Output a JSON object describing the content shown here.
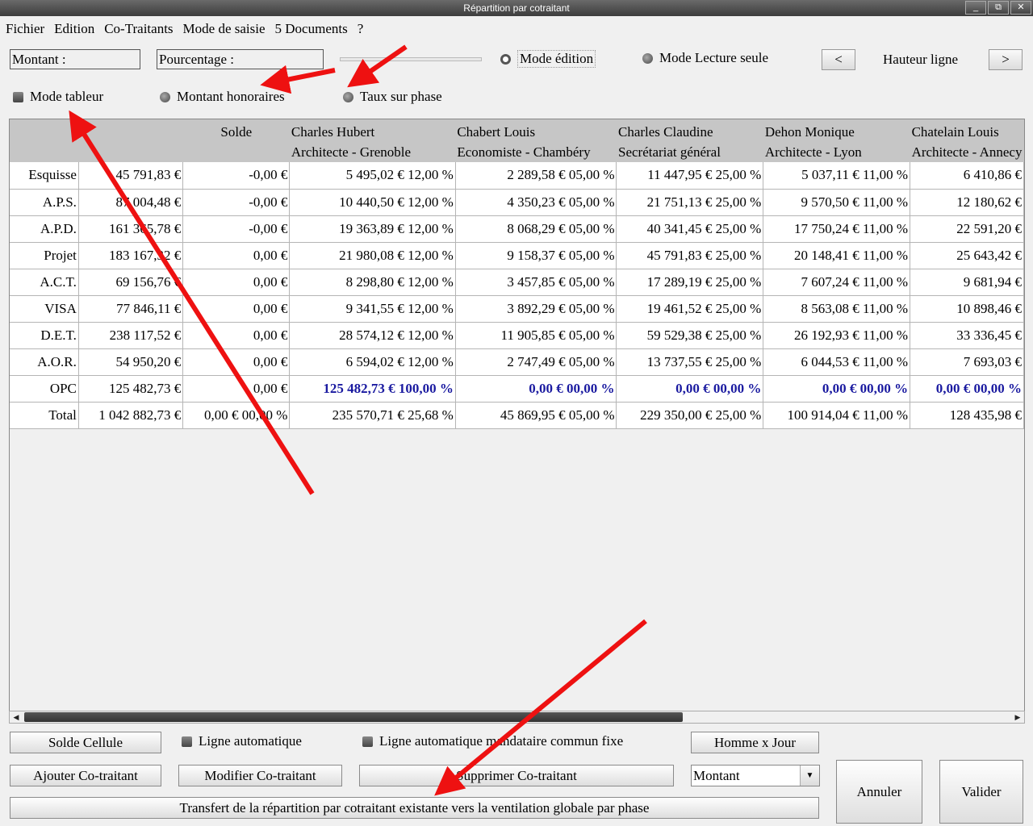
{
  "window": {
    "title": "Répartition par cotraitant",
    "minimize": "_",
    "maximize": "⧉",
    "close": "✕"
  },
  "menu": [
    "Fichier",
    "Edition",
    "Co-Traitants",
    "Mode de saisie",
    "5 Documents",
    "?"
  ],
  "toolbar": {
    "montant_label": "Montant :",
    "pourcentage_label": "Pourcentage :",
    "mode_edition": "Mode édition",
    "mode_lecture": "Mode Lecture seule",
    "prev": "<",
    "hauteur": "Hauteur ligne",
    "next": ">"
  },
  "modes": {
    "tableur": "Mode tableur",
    "honoraires": "Montant honoraires",
    "taux": "Taux sur phase"
  },
  "grid": {
    "columns": [
      {
        "name": "",
        "role": ""
      },
      {
        "name": "",
        "role": ""
      },
      {
        "name": "Solde",
        "role": ""
      },
      {
        "name": "Charles Hubert",
        "role": "Architecte - Grenoble"
      },
      {
        "name": "Chabert Louis",
        "role": "Economiste - Chambéry"
      },
      {
        "name": "Charles Claudine",
        "role": "Secrétariat général"
      },
      {
        "name": "Dehon Monique",
        "role": "Architecte - Lyon"
      },
      {
        "name": "Chatelain Louis",
        "role": "Architecte - Annecy"
      }
    ],
    "rows": [
      [
        "Esquisse",
        "45 791,83 €",
        "-0,00 €",
        "5 495,02 € 12,00 %",
        "2 289,58 € 05,00 %",
        "11 447,95 € 25,00 %",
        "5 037,11 € 11,00 %",
        "6 410,86 €"
      ],
      [
        "A.P.S.",
        "87 004,48 €",
        "-0,00 €",
        "10 440,50 € 12,00 %",
        "4 350,23 € 05,00 %",
        "21 751,13 € 25,00 %",
        "9 570,50 € 11,00 %",
        "12 180,62 €"
      ],
      [
        "A.P.D.",
        "161 365,78 €",
        "-0,00 €",
        "19 363,89 € 12,00 %",
        "8 068,29 € 05,00 %",
        "40 341,45 € 25,00 %",
        "17 750,24 € 11,00 %",
        "22 591,20 €"
      ],
      [
        "Projet",
        "183 167,32 €",
        "0,00 €",
        "21 980,08 € 12,00 %",
        "9 158,37 € 05,00 %",
        "45 791,83 € 25,00 %",
        "20 148,41 € 11,00 %",
        "25 643,42 €"
      ],
      [
        "A.C.T.",
        "69 156,76 €",
        "0,00 €",
        "8 298,80 € 12,00 %",
        "3 457,85 € 05,00 %",
        "17 289,19 € 25,00 %",
        "7 607,24 € 11,00 %",
        "9 681,94 €"
      ],
      [
        "VISA",
        "77 846,11 €",
        "0,00 €",
        "9 341,55 € 12,00 %",
        "3 892,29 € 05,00 %",
        "19 461,52 € 25,00 %",
        "8 563,08 € 11,00 %",
        "10 898,46 €"
      ],
      [
        "D.E.T.",
        "238 117,52 €",
        "0,00 €",
        "28 574,12 € 12,00 %",
        "11 905,85 € 05,00 %",
        "59 529,38 € 25,00 %",
        "26 192,93 € 11,00 %",
        "33 336,45 €"
      ],
      [
        "A.O.R.",
        "54 950,20 €",
        "0,00 €",
        "6 594,02 € 12,00 %",
        "2 747,49 € 05,00 %",
        "13 737,55 € 25,00 %",
        "6 044,53 € 11,00 %",
        "7 693,03 €"
      ],
      [
        "OPC",
        "125 482,73 €",
        "0,00 €",
        "125 482,73 € 100,00 %",
        "0,00 € 00,00 %",
        "0,00 € 00,00 %",
        "0,00 € 00,00 %",
        "0,00 € 00,00 %"
      ],
      [
        "Total",
        "1 042 882,73 €",
        "0,00 € 00,00 %",
        "235 570,71 € 25,68 %",
        "45 869,95 € 05,00 %",
        "229 350,00 € 25,00 %",
        "100 914,04 € 11,00 %",
        "128 435,98 €"
      ]
    ]
  },
  "bottom": {
    "solde_cellule": "Solde Cellule",
    "ligne_auto": "Ligne automatique",
    "ligne_auto_mandataire": "Ligne automatique mandataire commun fixe",
    "homme_jour": "Homme x Jour",
    "ajouter": "Ajouter Co-traitant",
    "modifier": "Modifier Co-traitant",
    "supprimer": "Supprimer Co-traitant",
    "select_value": "Montant",
    "transfert": "Transfert de la répartition par cotraitant existante vers la ventilation globale par phase",
    "annuler": "Annuler",
    "valider": "Valider"
  },
  "annotation_color": "#ee1111"
}
